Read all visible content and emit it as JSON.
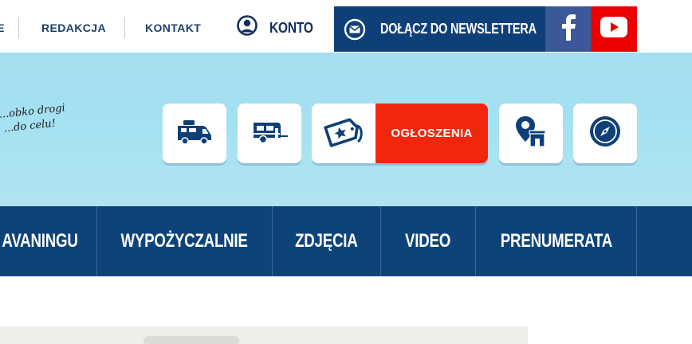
{
  "topbar": {
    "links": [
      {
        "label": "E",
        "name": "topnav-link-truncated"
      },
      {
        "label": "REDAKCJA",
        "name": "topnav-link-redakcja"
      },
      {
        "label": "KONTAKT",
        "name": "topnav-link-kontakt"
      }
    ],
    "account": {
      "label": "KONTO",
      "icon": "user-icon"
    },
    "newsletter": {
      "label": "DOŁĄCZ DO NEWSLETTERA",
      "icon": "envelope-icon"
    },
    "social": [
      {
        "name": "facebook",
        "icon": "facebook-icon",
        "color": "#3b5998"
      },
      {
        "name": "youtube",
        "icon": "youtube-icon",
        "color": "#ee0000"
      }
    ]
  },
  "header": {
    "slogan": [
      "...obko drogi",
      "...do celu!"
    ],
    "tiles": [
      {
        "icon": "camper-van-icon"
      },
      {
        "icon": "caravan-trailer-icon"
      },
      {
        "icon": "ad-ticket-icon",
        "label": "OGŁOSZENIA"
      },
      {
        "icon": "location-pin-building-icon"
      },
      {
        "icon": "compass-icon"
      }
    ]
  },
  "mainnav": {
    "items": [
      {
        "label": "AVANINGU"
      },
      {
        "label": "WYPOŻYCZALNIE"
      },
      {
        "label": "ZDJĘCIA"
      },
      {
        "label": "VIDEO"
      },
      {
        "label": "PRENUMERATA"
      }
    ]
  },
  "colors": {
    "navy": "#0d4379",
    "newsletter_bg": "#0f3f78",
    "facebook": "#3b5998",
    "youtube": "#ee0000",
    "ads_red": "#f2260d",
    "header_sky": "#a7ddf0"
  }
}
